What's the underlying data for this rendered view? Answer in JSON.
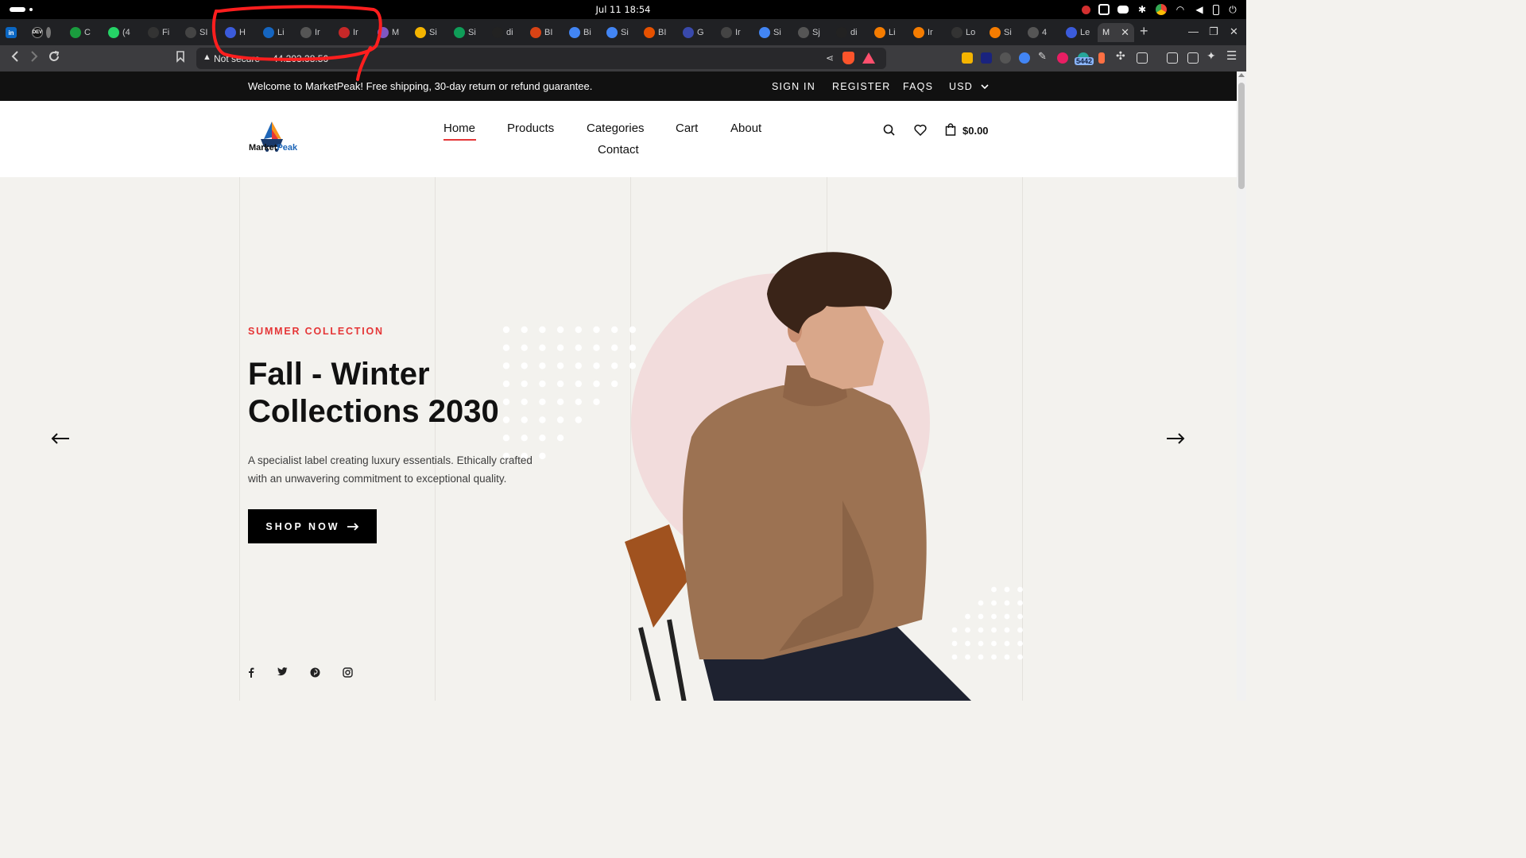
{
  "os": {
    "clock": "Jul 11  18:54"
  },
  "browser": {
    "tabs": [
      {
        "label": "C",
        "color": "#1a9c3e"
      },
      {
        "label": "(4",
        "color": "#25d366"
      },
      {
        "label": "Fi",
        "color": "#333"
      },
      {
        "label": "SI",
        "color": "#444"
      },
      {
        "label": "H",
        "color": "#3b5bdb"
      },
      {
        "label": "Li",
        "color": "#1565c0"
      },
      {
        "label": "Ir",
        "color": "#555"
      },
      {
        "label": "Ir",
        "color": "#c62828"
      },
      {
        "label": "M",
        "color": "#7e57c2"
      },
      {
        "label": "Si",
        "color": "#f4b400"
      },
      {
        "label": "Si",
        "color": "#0f9d58"
      },
      {
        "label": "di",
        "color": "#222"
      },
      {
        "label": "BI",
        "color": "#d84315"
      },
      {
        "label": "Bi",
        "color": "#4285f4"
      },
      {
        "label": "Si",
        "color": "#4285f4"
      },
      {
        "label": "BI",
        "color": "#e65100"
      },
      {
        "label": "G",
        "color": "#3949ab"
      },
      {
        "label": "Ir",
        "color": "#444"
      },
      {
        "label": "Si",
        "color": "#4285f4"
      },
      {
        "label": "Sj",
        "color": "#555"
      },
      {
        "label": "di",
        "color": "#222"
      },
      {
        "label": "Li",
        "color": "#f57c00"
      },
      {
        "label": "Ir",
        "color": "#f57c00"
      },
      {
        "label": "Lo",
        "color": "#333"
      },
      {
        "label": "Si",
        "color": "#f57c00"
      },
      {
        "label": "4",
        "color": "#555"
      },
      {
        "label": "Le",
        "color": "#3b5bdb"
      }
    ],
    "active_tab": {
      "label": "M",
      "close": "✕"
    },
    "address": {
      "security": "Not secure",
      "url": "44.203.38.56"
    },
    "extension_badge": "5442"
  },
  "site": {
    "announcement": "Welcome to MarketPeak! Free shipping, 30-day return or refund guarantee.",
    "top_links": [
      "SIGN IN",
      "REGISTER",
      "FAQS",
      "USD"
    ],
    "logo": {
      "part1": "Market",
      "part2": "Peak"
    },
    "nav": [
      "Home",
      "Products",
      "Categories",
      "Cart",
      "About",
      "Contact"
    ],
    "cart_total": "$0.00",
    "hero": {
      "kicker": "SUMMER COLLECTION",
      "title": "Fall - Winter Collections 2030",
      "description": "A specialist label creating luxury essentials. Ethically crafted with an unwavering commitment to exceptional quality.",
      "button": "SHOP NOW"
    },
    "colors": {
      "accent": "#e53637",
      "dark": "#111111",
      "bg": "#f3f2ee",
      "blush": "#f2dcdc"
    },
    "social": [
      "facebook-icon",
      "twitter-icon",
      "pinterest-icon",
      "instagram-icon"
    ]
  }
}
